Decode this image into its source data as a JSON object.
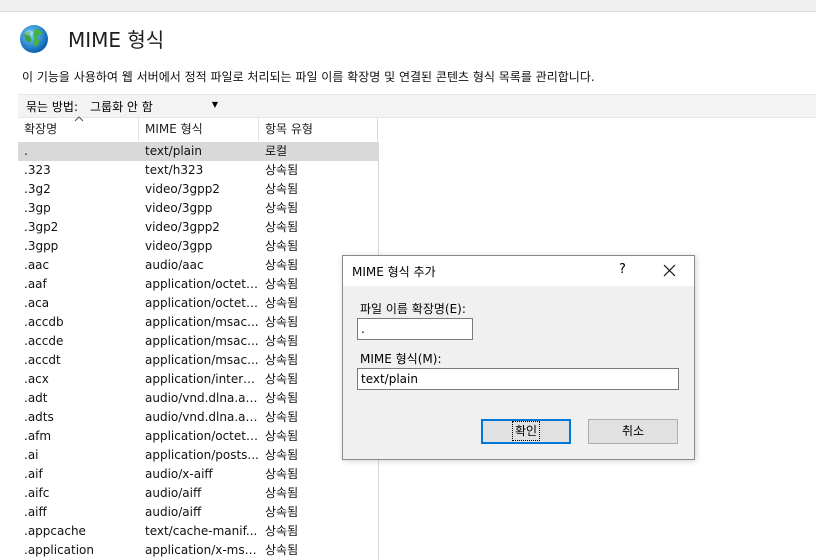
{
  "page": {
    "title": "MIME 형식",
    "description": "이 기능을 사용하여 웹 서버에서 정적 파일로 처리되는 파일 이름 확장명 및 연결된 콘텐츠 형식 목록를 관리합니다."
  },
  "group_by": {
    "label": "묶는 방법:",
    "value": "그룹화 안 함"
  },
  "grid": {
    "columns": [
      "확장명",
      "MIME 형식",
      "항목 유형"
    ],
    "rows": [
      [
        ".",
        "text/plain",
        "로컬"
      ],
      [
        ".323",
        "text/h323",
        "상속됨"
      ],
      [
        ".3g2",
        "video/3gpp2",
        "상속됨"
      ],
      [
        ".3gp",
        "video/3gpp",
        "상속됨"
      ],
      [
        ".3gp2",
        "video/3gpp2",
        "상속됨"
      ],
      [
        ".3gpp",
        "video/3gpp",
        "상속됨"
      ],
      [
        ".aac",
        "audio/aac",
        "상속됨"
      ],
      [
        ".aaf",
        "application/octet-...",
        "상속됨"
      ],
      [
        ".aca",
        "application/octet-...",
        "상속됨"
      ],
      [
        ".accdb",
        "application/msac...",
        "상속됨"
      ],
      [
        ".accde",
        "application/msac...",
        "상속됨"
      ],
      [
        ".accdt",
        "application/msac...",
        "상속됨"
      ],
      [
        ".acx",
        "application/intern...",
        "상속됨"
      ],
      [
        ".adt",
        "audio/vnd.dlna.adts",
        "상속됨"
      ],
      [
        ".adts",
        "audio/vnd.dlna.adts",
        "상속됨"
      ],
      [
        ".afm",
        "application/octet-...",
        "상속됨"
      ],
      [
        ".ai",
        "application/posts...",
        "상속됨"
      ],
      [
        ".aif",
        "audio/x-aiff",
        "상속됨"
      ],
      [
        ".aifc",
        "audio/aiff",
        "상속됨"
      ],
      [
        ".aiff",
        "audio/aiff",
        "상속됨"
      ],
      [
        ".appcache",
        "text/cache-manif...",
        "상속됨"
      ],
      [
        ".application",
        "application/x-ms-...",
        "상속됨"
      ]
    ]
  },
  "dialog": {
    "title": "MIME 형식 추가",
    "help": "?",
    "ext_label": "파일 이름 확장명(E):",
    "ext_value": ".",
    "mime_label": "MIME 형식(M):",
    "mime_value": "text/plain",
    "ok_label": "확인",
    "cancel_label": "취소"
  },
  "icons": {
    "page_icon": "globe-icon",
    "close": "close-icon",
    "dropdown": "chevron-down-icon",
    "sort": "sort-ascending-icon"
  },
  "colors": {
    "selected_row": "#d9d9d9",
    "focus_border": "#0078d7",
    "dialog_bg": "#f0f0f0"
  }
}
